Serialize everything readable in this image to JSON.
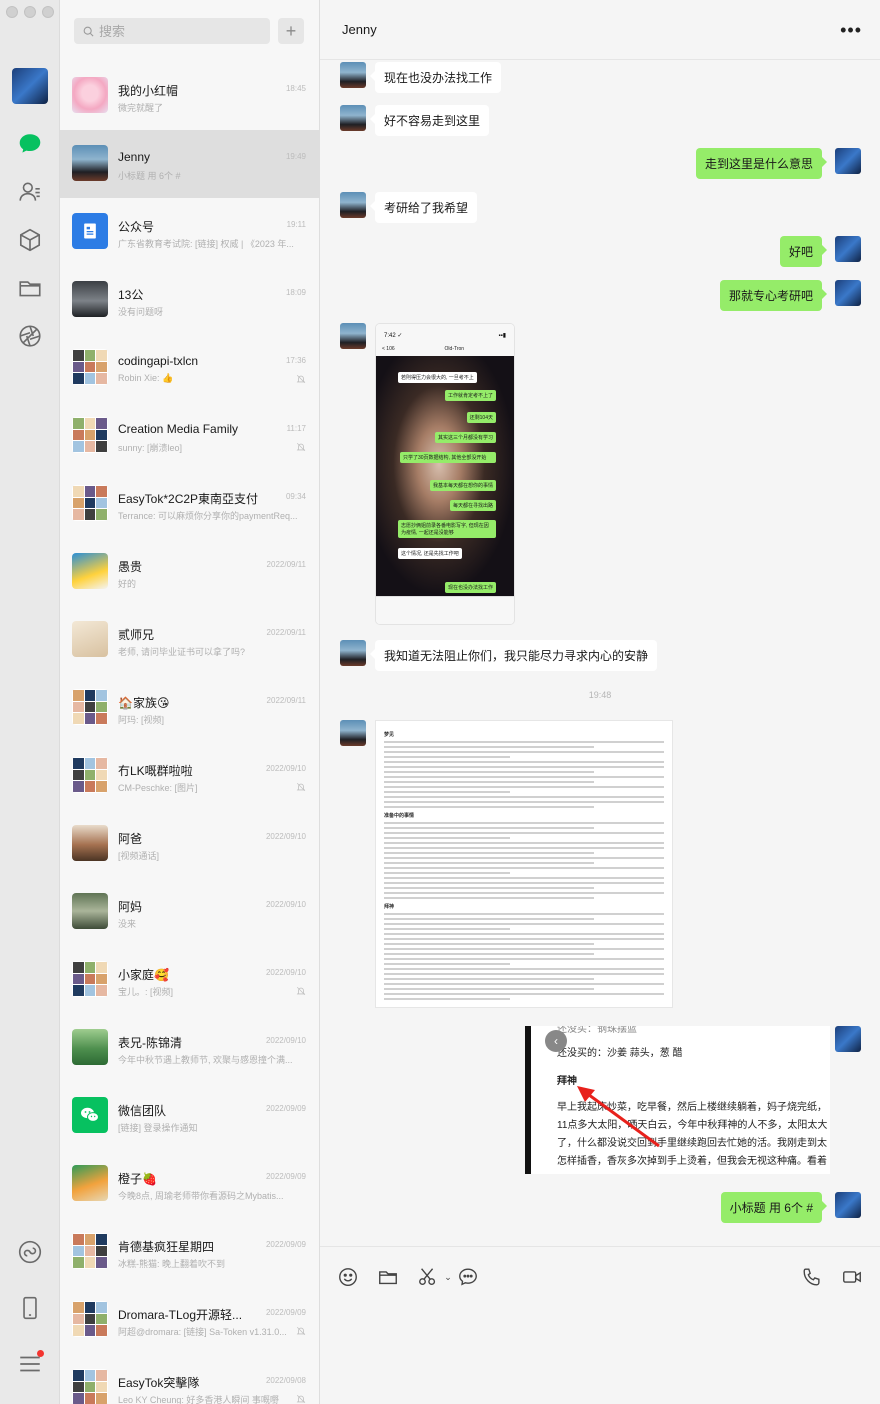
{
  "app": {
    "title": "WeChat"
  },
  "search": {
    "placeholder": "搜索",
    "add_label": "+"
  },
  "rail": {
    "icons": [
      "chat-icon",
      "contacts-icon",
      "favorites-icon",
      "folder-icon",
      "moments-icon",
      "miniprogram-icon",
      "phone-icon",
      "menu-icon"
    ],
    "accent": "#07c160"
  },
  "chats": [
    {
      "name": "我的小红帽",
      "preview": "微完就醒了",
      "time": "18:45",
      "muted": false
    },
    {
      "name": "Jenny",
      "preview": "小标题 用 6个 #",
      "time": "19:49",
      "muted": false
    },
    {
      "name": "公众号",
      "preview": "广东省教育考试院: [链接] 权威 | 《2023 年...",
      "time": "19:11",
      "muted": false
    },
    {
      "name": "13公",
      "preview": "没有问题呀",
      "time": "18:09",
      "muted": false
    },
    {
      "name": "codingapi-txlcn",
      "preview": "Robin Xie: 👍",
      "time": "17:36",
      "muted": true
    },
    {
      "name": "Creation Media Family",
      "preview": "sunny: [崩溃leo]",
      "time": "11:17",
      "muted": true
    },
    {
      "name": "EasyTok*2C2P東南亞支付",
      "preview": "Terrance: 可以麻烦你分享你的paymentReq...",
      "time": "09:34",
      "muted": false
    },
    {
      "name": "愚贵",
      "preview": "好的",
      "time": "2022/09/11",
      "muted": false
    },
    {
      "name": "贰师兄",
      "preview": "老师, 请问毕业证书可以拿了吗?",
      "time": "2022/09/11",
      "muted": false
    },
    {
      "name": "🏠家族😘",
      "preview": "阿玛: [视频]",
      "time": "2022/09/11",
      "muted": false
    },
    {
      "name": "冇LK嘅群啦啦",
      "preview": "CM-Peschke: [图片]",
      "time": "2022/09/10",
      "muted": true
    },
    {
      "name": "阿爸",
      "preview": "[视频通话]",
      "time": "2022/09/10",
      "muted": false
    },
    {
      "name": "阿妈",
      "preview": "没来",
      "time": "2022/09/10",
      "muted": false
    },
    {
      "name": "小家庭🥰",
      "preview": "宝儿。: [视频]",
      "time": "2022/09/10",
      "muted": true
    },
    {
      "name": "表兄-陈锦清",
      "preview": "今年中秋节遇上教师节, 欢聚与感恩撞个满...",
      "time": "2022/09/10",
      "muted": false
    },
    {
      "name": "微信团队",
      "preview": "[链接] 登录操作通知",
      "time": "2022/09/09",
      "muted": false
    },
    {
      "name": "橙子🍓",
      "preview": "今晚8点, 周瑜老师带你看源码之Mybatis...",
      "time": "2022/09/09",
      "muted": false
    },
    {
      "name": "肯德基疯狂星期四",
      "preview": "冰糕-熊猫: 晚上翻着吹不到",
      "time": "2022/09/09",
      "muted": false
    },
    {
      "name": "Dromara-TLog开源轻...",
      "preview": "阿超@dromara: [链接] Sa-Token v1.31.0...",
      "time": "2022/09/09",
      "muted": true
    },
    {
      "name": "EasyTok突擊隊",
      "preview": "Leo KY Cheung: 好多香港人瞬间 事嘅嘢",
      "time": "2022/09/08",
      "muted": true
    }
  ],
  "conversation": {
    "title": "Jenny",
    "more": "•••",
    "messages": [
      {
        "from": "them",
        "text": "现在也没办法找工作"
      },
      {
        "from": "them",
        "text": "好不容易走到这里"
      },
      {
        "from": "me",
        "text": "走到这里是什么意思"
      },
      {
        "from": "them",
        "text": "考研给了我希望"
      },
      {
        "from": "me",
        "text": "好吧"
      },
      {
        "from": "me",
        "text": "那就专心考研吧"
      },
      {
        "from": "them",
        "text": "我知道无法阻止你们，我只能尽力寻求内心的安静"
      },
      {
        "from": "me",
        "text": "小标题 用 6个 #"
      }
    ],
    "timestamp": "19:48",
    "phone_shot": {
      "status_time": "7:42 ✓",
      "nav_title": "Old-Tron",
      "back": "< 106",
      "bubbles": [
        {
          "from": "them",
          "text": "若則得压力会很大的, 一旦考不上"
        },
        {
          "from": "me",
          "text": "工作就肯定考不上了"
        },
        {
          "from": "me",
          "text": "还剩104天"
        },
        {
          "from": "me",
          "text": "其实这三个月都没有学习"
        },
        {
          "from": "me",
          "text": "只学了30页数据结构, 其他全部没开始"
        },
        {
          "from": "me",
          "text": "我基本每天都在想你的事情"
        },
        {
          "from": "me",
          "text": "每天都在寻找出路"
        },
        {
          "from": "me",
          "text": "志愿抄俩姐前录各番电影写字, 但现在因为疫情, 一起还是没能够"
        },
        {
          "from": "them",
          "text": "这个情况, 还是先找工作吧"
        },
        {
          "from": "me",
          "text": "现在也没办法找工作"
        }
      ]
    },
    "doc_shot": {
      "title": "梦见",
      "section1": "准备中的事情",
      "section2": "拜神"
    },
    "note_shot": {
      "lines": [
        "还没买的：沙姜 蒜头，葱 醋",
        "拜神",
        "早上我起床炒菜，吃早餐，然后上楼继续躺着，妈子烧完纸，",
        "11点多大太阳，晒天白云，今年中秋拜神的人不多，太阳太大",
        "了，什么都没说交回到手里继续跑回去忙她的活。我刚走到太",
        "怎样插香，香灰多次掉到手上烫着，但我会无视这种痛。看着"
      ],
      "top_text": "还没买：钢珠摆篮"
    }
  },
  "composer": {
    "tools": [
      "emoji-icon",
      "folder-icon",
      "scissors-icon",
      "chat-bubble-icon",
      "call-icon",
      "video-icon"
    ]
  }
}
